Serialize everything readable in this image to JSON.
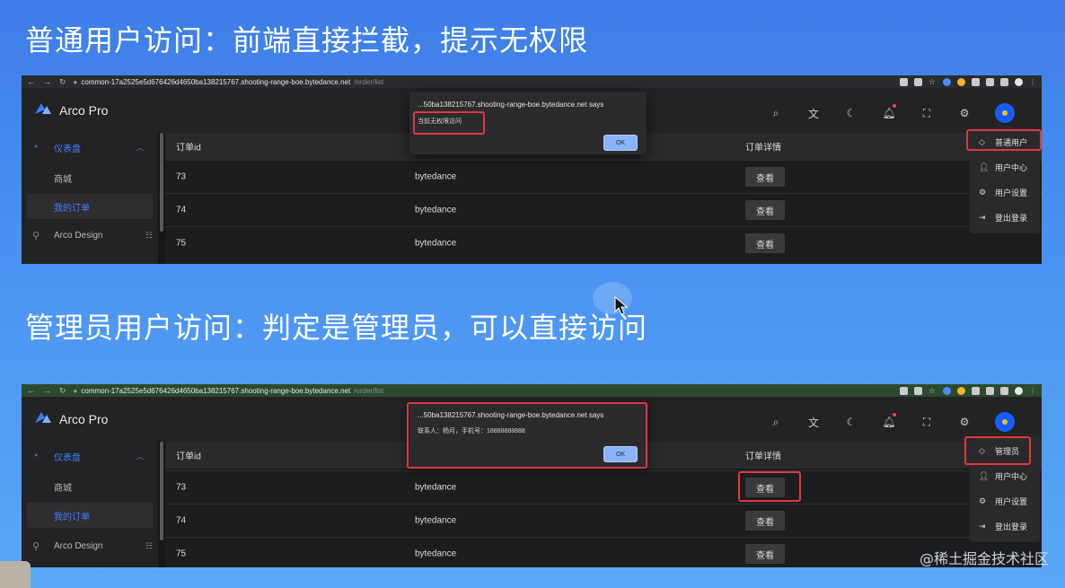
{
  "headings": {
    "top": "普通用户访问：前端直接拦截，提示无权限",
    "bottom": "管理员用户访问：判定是管理员，可以直接访问"
  },
  "browser": {
    "url_host": "common-17a2525e5d676426d4650ba138215767.shooting-range-boe.bytedance.net",
    "url_path": "/order/list"
  },
  "app": {
    "brand": "Arco Pro",
    "header_icons": [
      "search-icon",
      "translate-icon",
      "moon-icon",
      "bell-icon",
      "fullscreen-icon",
      "gear-icon"
    ]
  },
  "sidebar": {
    "dashboard": "仪表盘",
    "mall": "商城",
    "my_orders": "我的订单",
    "arco_design": "Arco Design"
  },
  "table": {
    "col_id": "订单id",
    "col_detail": "订单详情",
    "view_label": "查看",
    "rows": [
      {
        "id": "73",
        "name": "bytedance"
      },
      {
        "id": "74",
        "name": "bytedance"
      },
      {
        "id": "75",
        "name": "bytedance"
      }
    ]
  },
  "panel_user": {
    "dialog_origin": "...50ba138215767.shooting-range-boe.bytedance.net says",
    "dialog_message": "当前无权限访问",
    "ok": "OK",
    "menu": [
      "普通用户",
      "用户中心",
      "用户设置",
      "登出登录"
    ]
  },
  "panel_admin": {
    "dialog_origin": "...50ba138215767.shooting-range-boe.bytedance.net says",
    "dialog_message": "联系人：杨月，手机号：18888888888",
    "ok": "OK",
    "menu": [
      "管理员",
      "用户中心",
      "用户设置",
      "登出登录"
    ]
  },
  "watermark": "@稀土掘金技术社区",
  "colors": {
    "accent": "#165dff",
    "highlight": "#e0383a"
  }
}
